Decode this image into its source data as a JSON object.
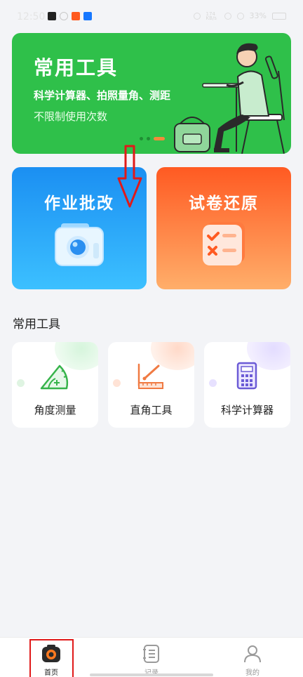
{
  "status_bar": {
    "time": "12:50",
    "signal_text": "174 KB/s",
    "battery": "33%"
  },
  "banner": {
    "title": "常用工具",
    "subtitle": "科学计算器、拍照量角、测距",
    "description": "不限制使用次数",
    "illustration": "student-studying-illustration",
    "accent_color": "#2fc04a"
  },
  "features": [
    {
      "label": "作业批改",
      "icon": "camera-icon",
      "color": "#1b8ff2"
    },
    {
      "label": "试卷还原",
      "icon": "checklist-icon",
      "color": "#ff5a22"
    }
  ],
  "tools_section": {
    "title": "常用工具",
    "items": [
      {
        "label": "角度测量",
        "icon": "protractor-icon",
        "color": "#36b34a"
      },
      {
        "label": "直角工具",
        "icon": "set-square-icon",
        "color": "#f07a42"
      },
      {
        "label": "科学计算器",
        "icon": "calculator-icon",
        "color": "#6b5bd6"
      }
    ]
  },
  "bottom_nav": {
    "items": [
      {
        "label": "首页",
        "icon": "camera-home-icon",
        "active": true
      },
      {
        "label": "记录",
        "icon": "records-icon",
        "active": false
      },
      {
        "label": "我的",
        "icon": "profile-icon",
        "active": false
      }
    ]
  },
  "annotations": {
    "arrow_color": "#e01919"
  }
}
